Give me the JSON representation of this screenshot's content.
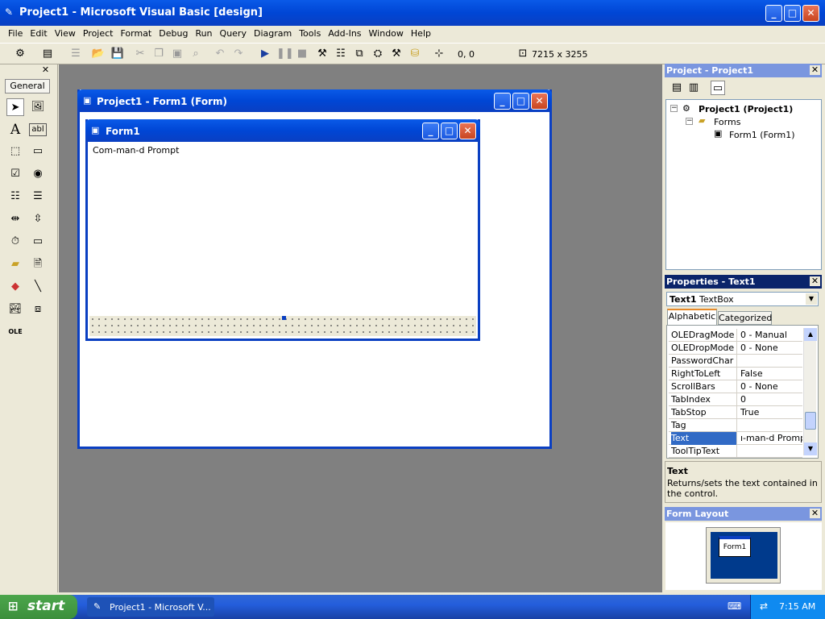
{
  "window": {
    "title": "Project1 - Microsoft Visual Basic [design]"
  },
  "menu": [
    "File",
    "Edit",
    "View",
    "Project",
    "Format",
    "Debug",
    "Run",
    "Query",
    "Diagram",
    "Tools",
    "Add-Ins",
    "Window",
    "Help"
  ],
  "toolbar": {
    "position": "0, 0",
    "size": "7215 x 3255"
  },
  "toolbox": {
    "tab_label": "General"
  },
  "designer": {
    "outer_title": "Project1 - Form1 (Form)",
    "form_title": "Form1",
    "textbox_text": "Com-man-d Prompt"
  },
  "project": {
    "panel_title": "Project - Project1",
    "root": "Project1 (Project1)",
    "folder": "Forms",
    "item": "Form1 (Form1)"
  },
  "properties": {
    "panel_title": "Properties - Text1",
    "object_name": "Text1",
    "object_type": "TextBox",
    "tabs": [
      "Alphabetic",
      "Categorized"
    ],
    "rows": [
      {
        "name": "OLEDragMode",
        "value": "0 - Manual"
      },
      {
        "name": "OLEDropMode",
        "value": "0 - None"
      },
      {
        "name": "PasswordChar",
        "value": ""
      },
      {
        "name": "RightToLeft",
        "value": "False"
      },
      {
        "name": "ScrollBars",
        "value": "0 - None"
      },
      {
        "name": "TabIndex",
        "value": "0"
      },
      {
        "name": "TabStop",
        "value": "True"
      },
      {
        "name": "Tag",
        "value": ""
      },
      {
        "name": "Text",
        "value": "ı-man-d Prompt"
      },
      {
        "name": "ToolTipText",
        "value": ""
      }
    ],
    "desc_title": "Text",
    "desc_text": "Returns/sets the text contained in the control."
  },
  "form_layout": {
    "panel_title": "Form Layout",
    "preview_label": "Form1"
  },
  "taskbar": {
    "start": "start",
    "task": "Project1 - Microsoft V...",
    "clock": "7:15 AM"
  }
}
